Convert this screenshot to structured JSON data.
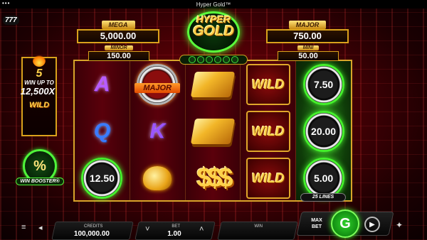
{
  "window": {
    "title": "Hyper Gold™",
    "menu_dots": "•••"
  },
  "brand": {
    "badge": "777"
  },
  "jackpots": {
    "mega": {
      "label": "MEGA",
      "value": "5,000.00"
    },
    "minor": {
      "label": "MINOR",
      "value": "150.00"
    },
    "major": {
      "label": "MAJOR",
      "value": "750.00"
    },
    "mini": {
      "label": "MINI",
      "value": "50.00"
    }
  },
  "logo": {
    "line1": "HYPER",
    "line2": "GOLD"
  },
  "feature": {
    "count": "5",
    "line1": "WIN UP TO",
    "amount": "12,500X",
    "symbol": "WILD"
  },
  "booster": {
    "label": "WIN BOOSTER®",
    "glyph": "%"
  },
  "reels": [
    [
      {
        "type": "letter",
        "text": "A",
        "cls": "sym-A"
      },
      {
        "type": "letter",
        "text": "Q",
        "cls": "sym-Q"
      },
      {
        "type": "chip",
        "text": "12.50"
      }
    ],
    [
      {
        "type": "jackpotchip",
        "text": "MAJOR"
      },
      {
        "type": "letter",
        "text": "K",
        "cls": "sym-K"
      },
      {
        "type": "coins",
        "text": ""
      }
    ],
    [
      {
        "type": "gold",
        "text": ""
      },
      {
        "type": "gold",
        "text": ""
      },
      {
        "type": "dollars",
        "text": "$$$"
      }
    ],
    [
      {
        "type": "wild",
        "text": "WILD"
      },
      {
        "type": "wild",
        "text": "WILD"
      },
      {
        "type": "wild",
        "text": "WILD"
      }
    ],
    [
      {
        "type": "chip",
        "text": "7.50"
      },
      {
        "type": "chip",
        "text": "20.00"
      },
      {
        "type": "chip",
        "text": "5.00"
      }
    ]
  ],
  "lines_label": "25 LINES",
  "hud": {
    "credits_label": "CREDITS",
    "credits_value": "100,000.00",
    "bet_label": "BET",
    "bet_value": "1.00",
    "win_label": "WIN",
    "win_value": "",
    "maxbet_label_1": "MAX",
    "maxbet_label_2": "BET",
    "menu_icon": "≡",
    "sound_icon": "◂",
    "bet_down": "˅",
    "bet_up": "˄",
    "spin_glyph": "G",
    "auto_glyph": "▶",
    "settings_icon": "✦"
  },
  "colors": {
    "accent_green": "#45f02c",
    "gold": "#d9a21c",
    "background_red": "#4b0005"
  }
}
